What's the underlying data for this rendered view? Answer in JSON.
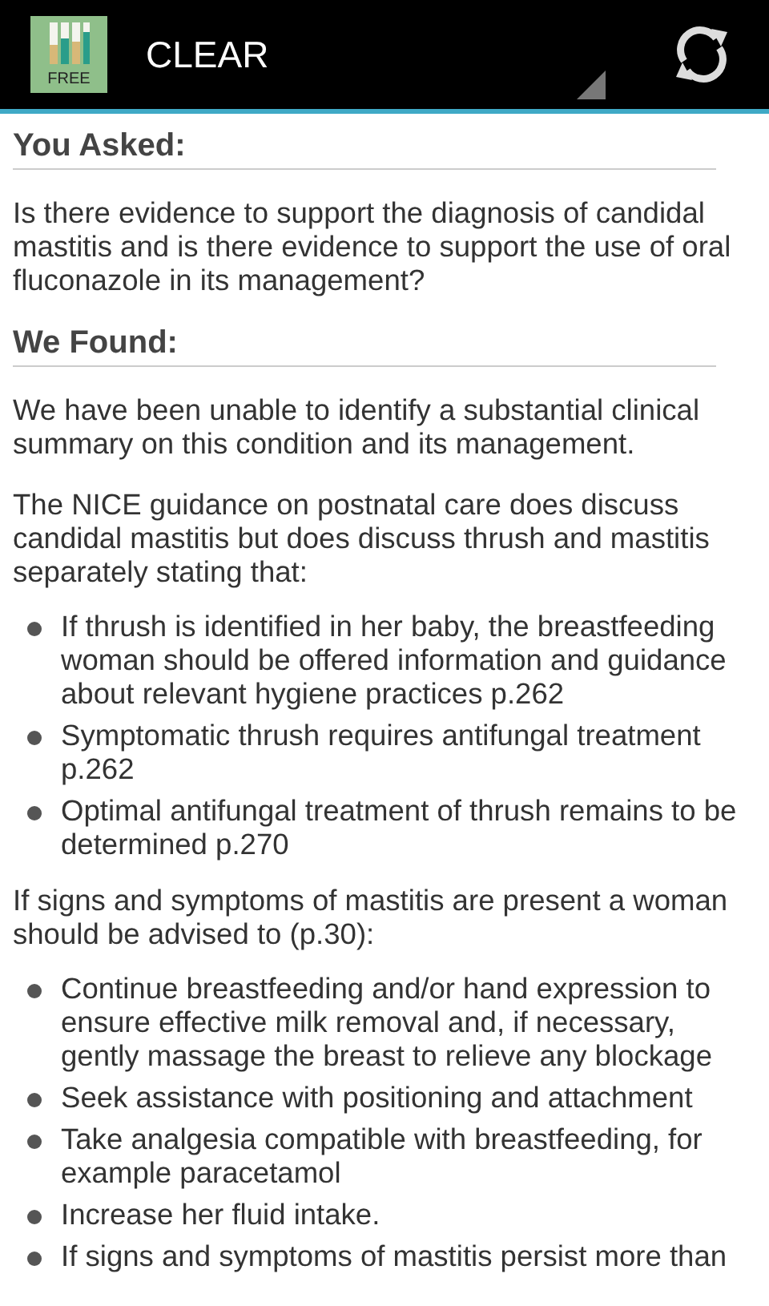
{
  "action_bar": {
    "icon_label": "FREE",
    "title": "CLEAR"
  },
  "sections": [
    {
      "heading": "You Asked:",
      "blocks": [
        {
          "kind": "paragraph",
          "text": "Is there evidence to support the diagnosis of candidal mastitis and is there evidence to support the use of oral fluconazole in its management?"
        }
      ]
    },
    {
      "heading": "We Found:",
      "blocks": [
        {
          "kind": "paragraph",
          "text": "We have been unable to identify a substantial clinical summary on this condition and its management."
        },
        {
          "kind": "paragraph",
          "text": "The NICE guidance on postnatal care does discuss candidal mastitis but does discuss thrush and mastitis separately stating that:"
        },
        {
          "kind": "list",
          "items": [
            "If thrush is identified in her baby, the breastfeeding woman should be offered information and guidance about relevant hygiene practices p.262",
            "Symptomatic thrush requires antifungal treatment p.262",
            "Optimal antifungal treatment of thrush remains to be determined p.270"
          ]
        },
        {
          "kind": "paragraph",
          "text": "If signs and symptoms of mastitis are present a woman should be advised to (p.30):"
        },
        {
          "kind": "list",
          "items": [
            "Continue breastfeeding and/or hand expression to ensure effective milk removal and, if necessary, gently massage the breast to relieve any blockage",
            "Seek assistance with positioning and attachment",
            "Take analgesia compatible with breastfeeding, for example paracetamol",
            "Increase her fluid intake.",
            "If signs and symptoms of mastitis persist more than"
          ]
        }
      ]
    }
  ]
}
